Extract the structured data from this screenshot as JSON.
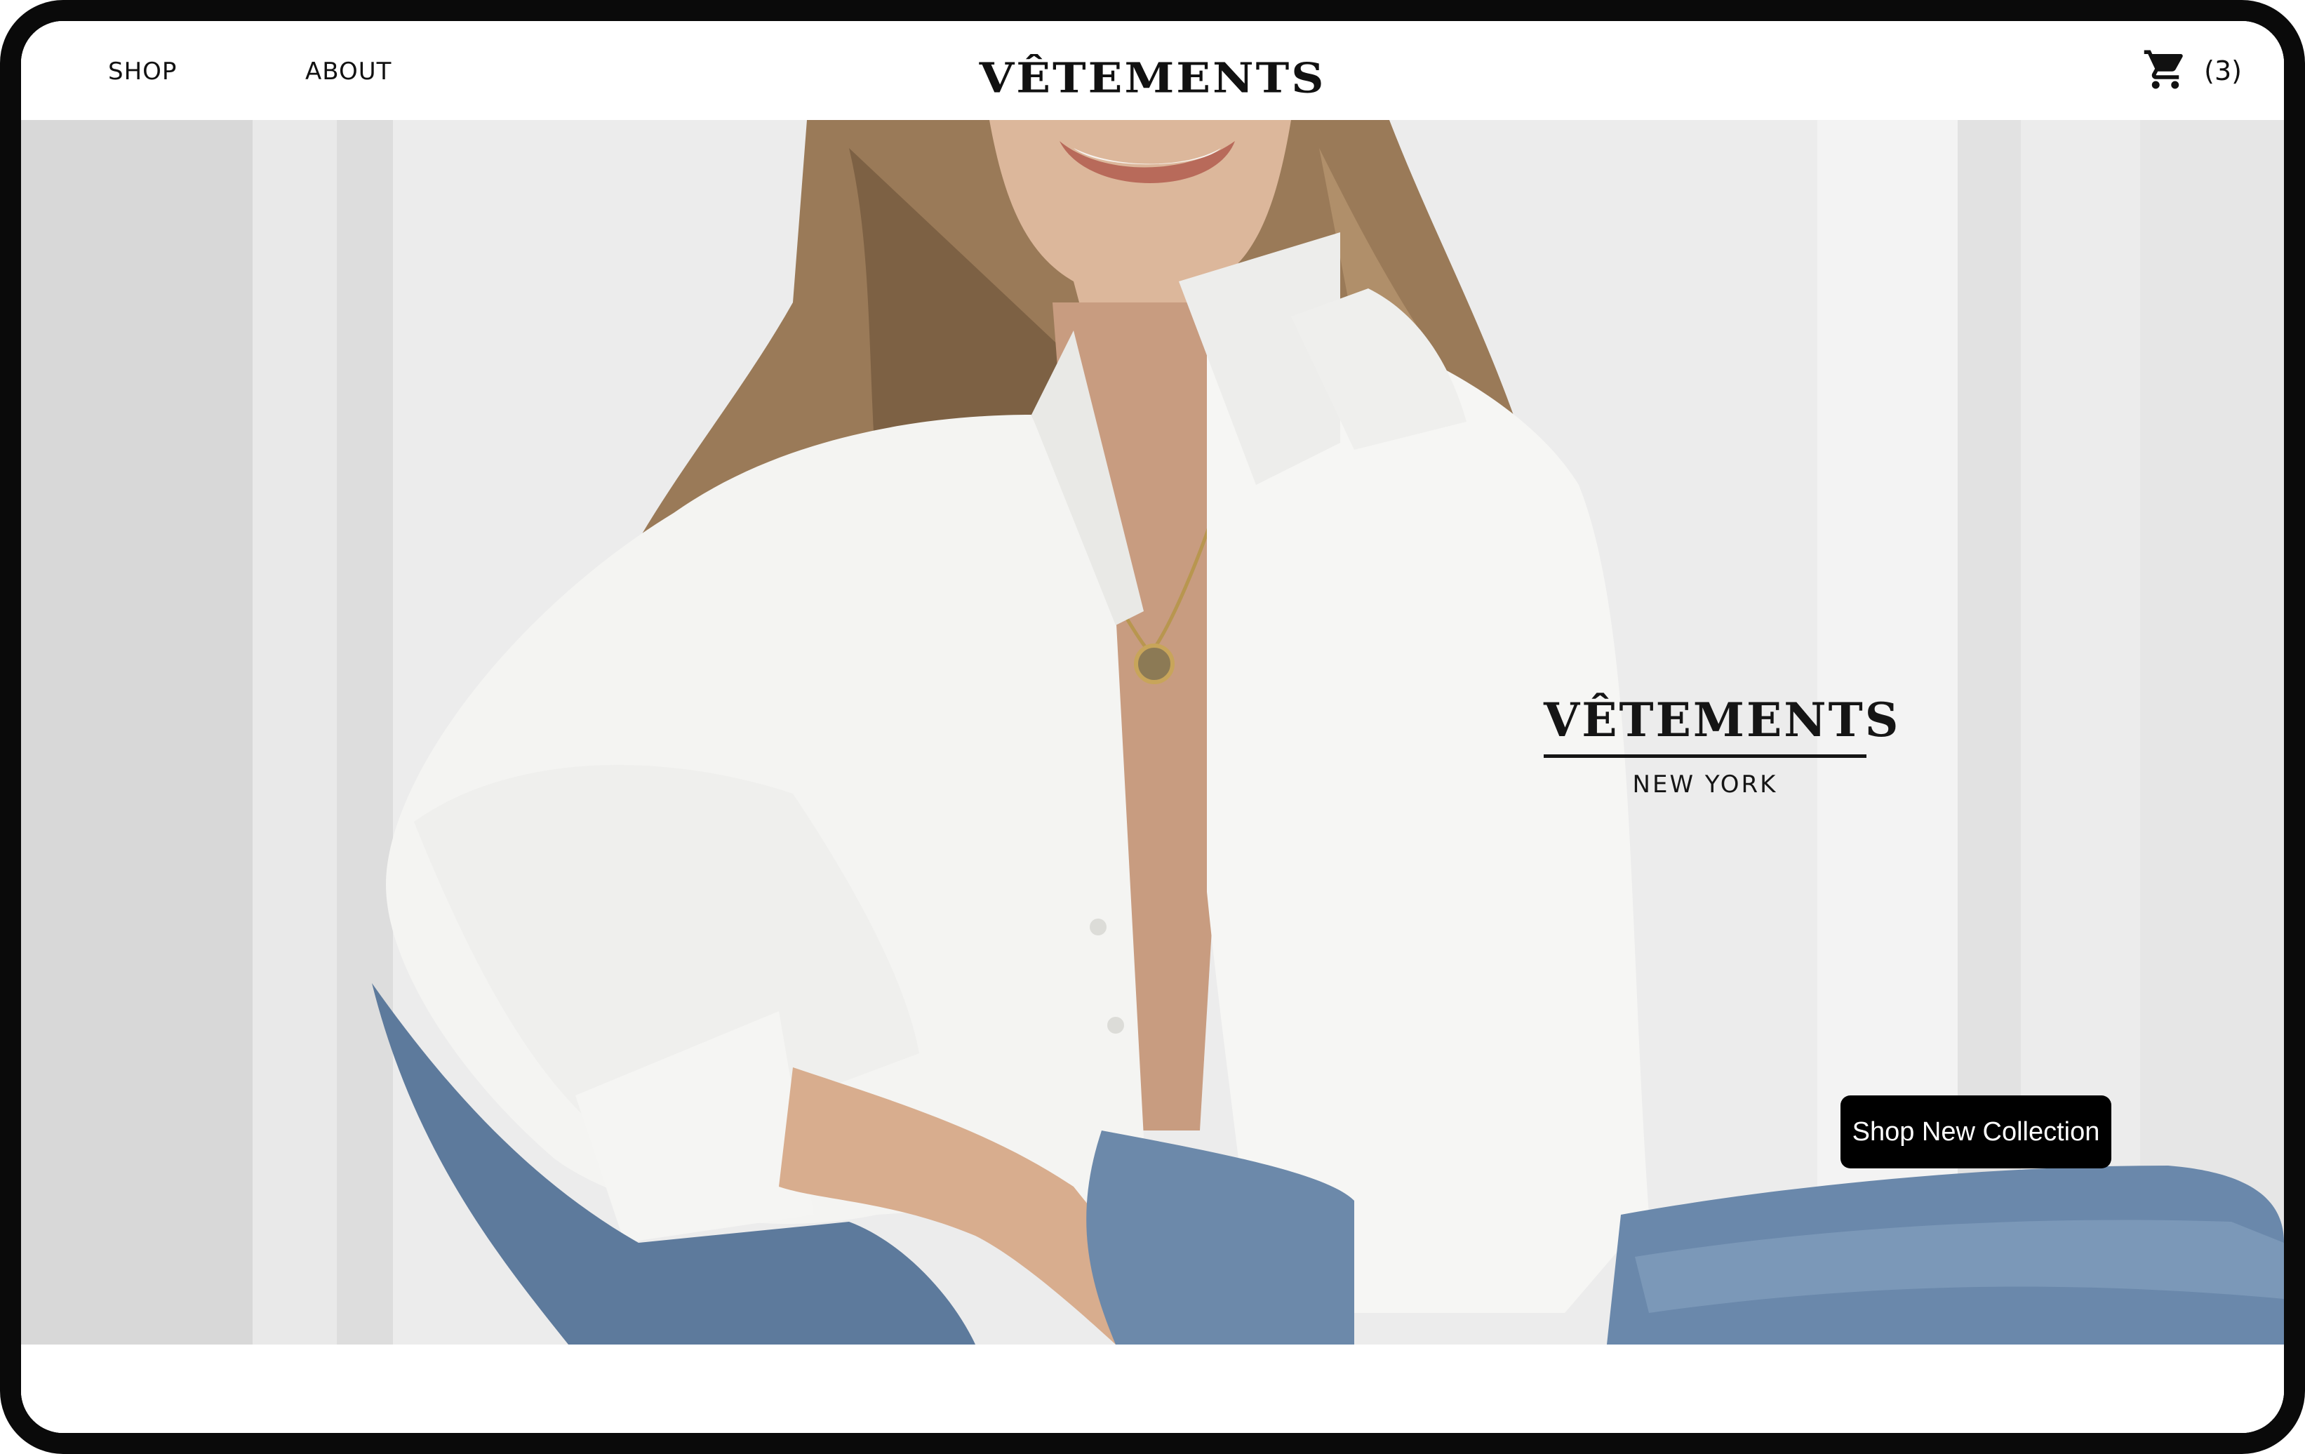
{
  "header": {
    "nav": [
      {
        "label": "SHOP"
      },
      {
        "label": "ABOUT"
      }
    ],
    "logo": "VÊTEMENTS",
    "cart": {
      "icon": "cart-icon",
      "count": "(3)"
    }
  },
  "hero": {
    "image": "woman-in-white-shirt-photo",
    "brand_name": "VÊTEMENTS",
    "brand_city": "NEW YORK",
    "cta_label": "Shop New Collection"
  },
  "colors": {
    "text": "#111111",
    "button_bg": "#000000",
    "button_text": "#ffffff",
    "frame": "#0a0a0a"
  }
}
